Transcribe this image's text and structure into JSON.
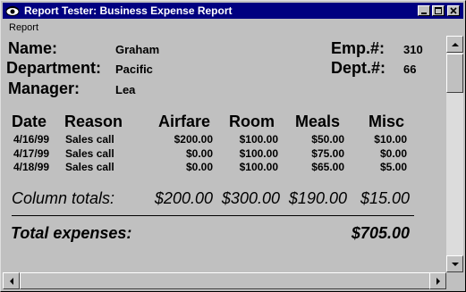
{
  "window": {
    "title": "Report Tester: Business Expense Report"
  },
  "menu": {
    "items": [
      "Report"
    ]
  },
  "employee": {
    "name_label": "Name:",
    "name": "Graham",
    "department_label": "Department:",
    "department": "Pacific",
    "manager_label": "Manager:",
    "manager": "Lea",
    "emp_no_label": "Emp.#:",
    "emp_no": "310",
    "dept_no_label": "Dept.#:",
    "dept_no": "66"
  },
  "table": {
    "headers": [
      "Date",
      "Reason",
      "Airfare",
      "Room",
      "Meals",
      "Misc"
    ],
    "rows": [
      [
        "4/16/99",
        "Sales call",
        "$200.00",
        "$100.00",
        "$50.00",
        "$10.00"
      ],
      [
        "4/17/99",
        "Sales call",
        "$0.00",
        "$100.00",
        "$75.00",
        "$0.00"
      ],
      [
        "4/18/99",
        "Sales call",
        "$0.00",
        "$100.00",
        "$65.00",
        "$5.00"
      ]
    ]
  },
  "totals": {
    "label": "Column totals:",
    "airfare": "$200.00",
    "room": "$300.00",
    "meals": "$190.00",
    "misc": "$15.00"
  },
  "grand_total": {
    "label": "Total expenses:",
    "value": "$705.00"
  },
  "colors": {
    "titlebar": "#000080",
    "face": "#c0c0c0"
  }
}
